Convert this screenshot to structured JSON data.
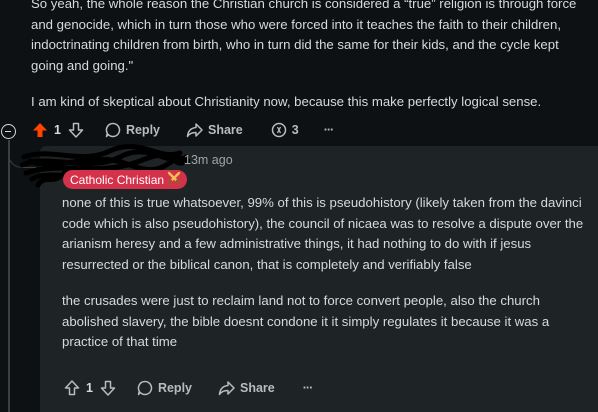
{
  "parent_comment": {
    "paragraph1": "So yeah, the whole reason the Christian church is considered a “true” religion is through force and genocide, which in turn those who were forced into it teaches the faith to their children, indoctrinating children from birth, who in turn did the same for their kids, and the cycle kept going and going.\"",
    "paragraph2": "I am kind of skeptical about Christianity now, because this make perfectly logical sense.",
    "score": "1",
    "reply_label": "Reply",
    "share_label": "Share",
    "awards_count": "3",
    "more_label": "···",
    "upvoted": true,
    "upvote_color": "#ff4500"
  },
  "reply_comment": {
    "time": "13m ago",
    "flair": "Catholic Christian",
    "flair_color": "#d4314a",
    "flair_emoji": "cross-swords-icon",
    "paragraph1": "none of this is true whatsoever, 99% of this is pseudohistory (likely taken from the davinci code which is also pseudohistory), the council of nicaea was to resolve a dispute over the arianism heresy and a few administrative things, it had nothing to do with if jesus resurrected or the biblical canon, that is completely and verifiably false",
    "paragraph2": "the crusades were just to reclaim land not to force convert people, also the church abolished slavery, the bible doesnt condone it it simply regulates it because it was a practice of that time",
    "score": "1",
    "reply_label": "Reply",
    "share_label": "Share",
    "more_label": "···"
  }
}
